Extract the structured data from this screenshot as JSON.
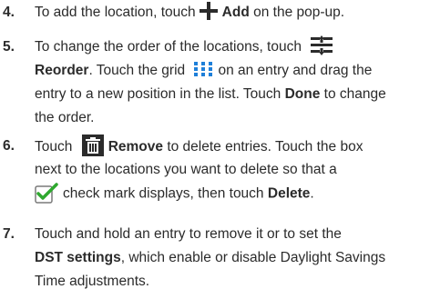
{
  "steps": [
    {
      "number": "4.",
      "lines": [
        {
          "pre": "To add the location, touch",
          "bold": "Add",
          "post": "on the pop-up."
        }
      ]
    },
    {
      "number": "5.",
      "line1": "To change the order of the locations, touch",
      "line2_bold": "Reorder",
      "line2_mid": ". Touch the grid",
      "line2_post": "on an entry and drag the",
      "line3_pre": "entry to a new position in the list. Touch",
      "line3_bold": "Done",
      "line3_post": "to change",
      "line4": "the order."
    },
    {
      "number": "6.",
      "line1_pre": "Touch",
      "line1_bold": "Remove",
      "line1_post": "to delete entries. Touch the box",
      "line2": "next to the locations you want to delete so that a",
      "line3_pre": "check mark displays, then touch",
      "line3_bold": "Delete",
      "line3_post": "."
    },
    {
      "number": "7.",
      "line1": "Touch and hold an entry to remove it or to set the",
      "line2_bold": "DST settings",
      "line2_post": ", which enable or disable Daylight Savings",
      "line3": "Time adjustments."
    }
  ],
  "icons": {
    "add": "plus-icon",
    "reorder": "reorder-icon",
    "grid": "grid-handle-icon",
    "remove": "trash-icon",
    "checkbox": "checkbox-checked-icon"
  },
  "colors": {
    "text": "#2b2b2b",
    "grid_blue": "#1e7fd9",
    "check_green": "#2fa82f"
  }
}
